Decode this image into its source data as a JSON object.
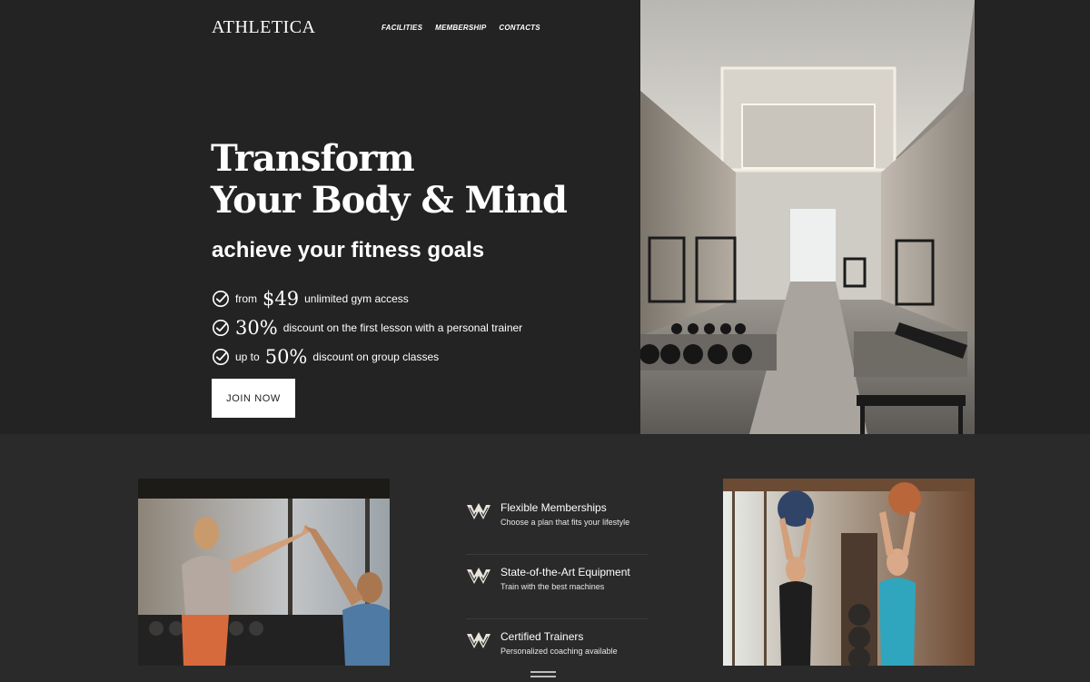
{
  "header": {
    "logo": "ATHLETICA",
    "nav": [
      {
        "label": "FACILITIES"
      },
      {
        "label": "MEMBERSHIP"
      },
      {
        "label": "CONTACTS"
      }
    ]
  },
  "hero": {
    "headline_line1": "Transform",
    "headline_line2": "Your Body & Mind",
    "subheadline": "achieve your fitness goals",
    "bullets": [
      {
        "pre": "from",
        "big": "$49",
        "post": "unlimited gym access"
      },
      {
        "pre": "",
        "big": "30%",
        "post": "discount on the first lesson with a personal trainer"
      },
      {
        "pre": "up to",
        "big": "50%",
        "post": "discount on group classes"
      }
    ],
    "cta_label": "JOIN NOW",
    "image_icon": "gym-interior-photo"
  },
  "features": [
    {
      "title": "Flexible Memberships",
      "desc": "Choose a plan that fits your lifestyle",
      "icon": "athletica-emblem-icon"
    },
    {
      "title": "State-of-the-Art Equipment",
      "desc": "Train with the best machines",
      "icon": "athletica-emblem-icon"
    },
    {
      "title": "Certified Trainers",
      "desc": "Personalized coaching available",
      "icon": "athletica-emblem-icon"
    }
  ],
  "images": {
    "left": "trainer-high-five-photo",
    "right": "women-medicine-ball-photo"
  },
  "colors": {
    "hero_bg": "#232323",
    "page_bg": "#2a2a2b",
    "button_bg": "#ffffff",
    "text": "#ffffff"
  }
}
